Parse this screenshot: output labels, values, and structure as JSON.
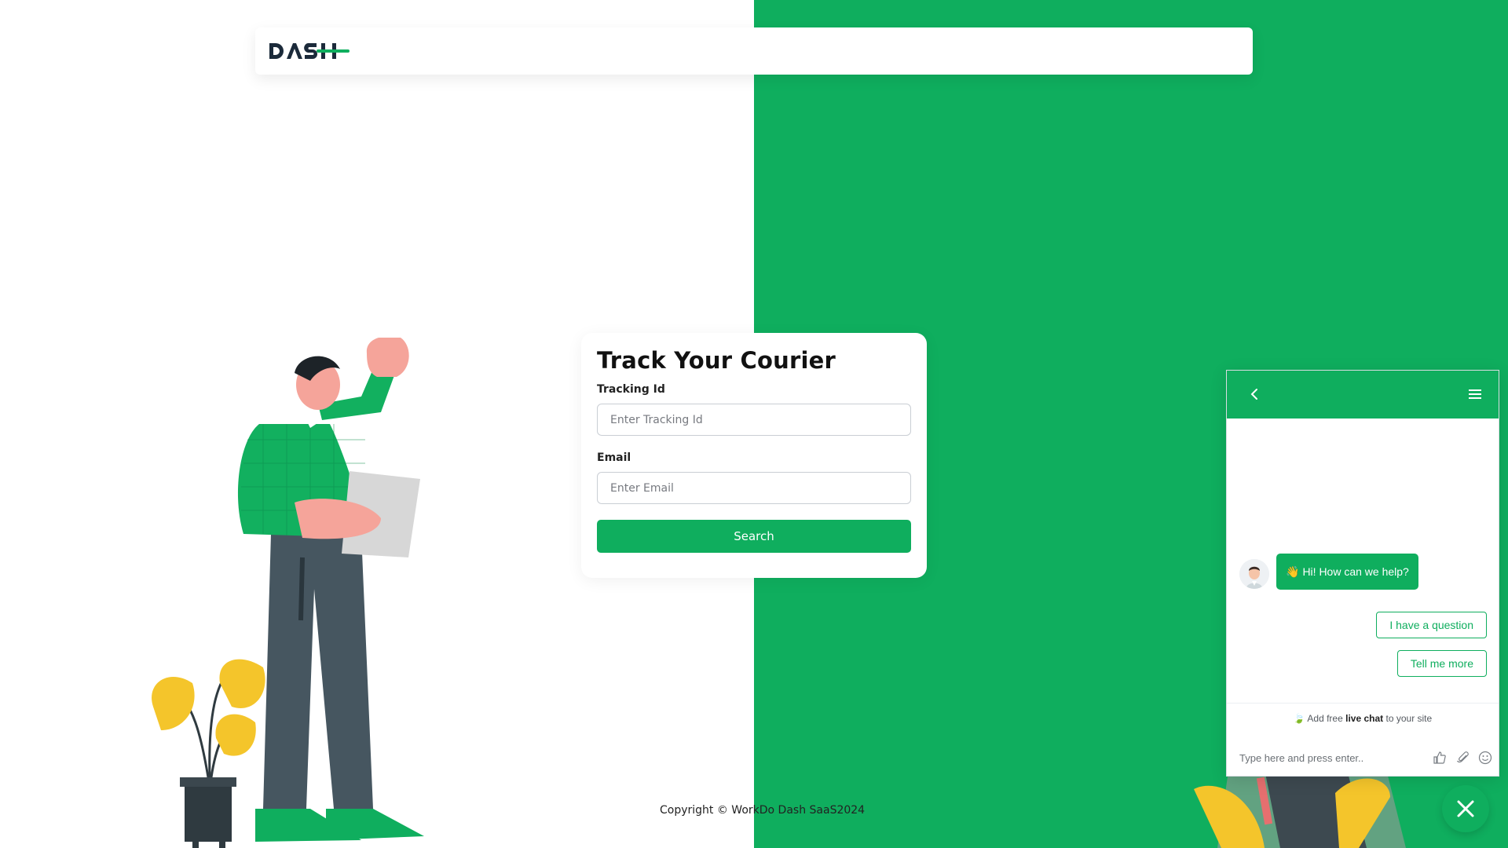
{
  "brand": {
    "logo_text": "DASH",
    "primary_color": "#0fae5e"
  },
  "track_form": {
    "title": "Track Your Courier",
    "tracking_label": "Tracking Id",
    "tracking_placeholder": "Enter Tracking Id",
    "email_label": "Email",
    "email_placeholder": "Enter Email",
    "search_button": "Search"
  },
  "footer": {
    "copyright": "Copyright © WorkDo Dash SaaS2024"
  },
  "chat_widget": {
    "greeting": "Hi! How can we help?",
    "greeting_emoji": "👋",
    "quick_replies": [
      "I have a question",
      "Tell me more"
    ],
    "promo_prefix": "Add free",
    "promo_bold": "live chat",
    "promo_suffix": "to your site",
    "input_placeholder": "Type here and press enter..",
    "icons": [
      "back-icon",
      "menu-icon",
      "thumbs-up-icon",
      "paperclip-icon",
      "emoji-icon",
      "close-icon"
    ]
  }
}
